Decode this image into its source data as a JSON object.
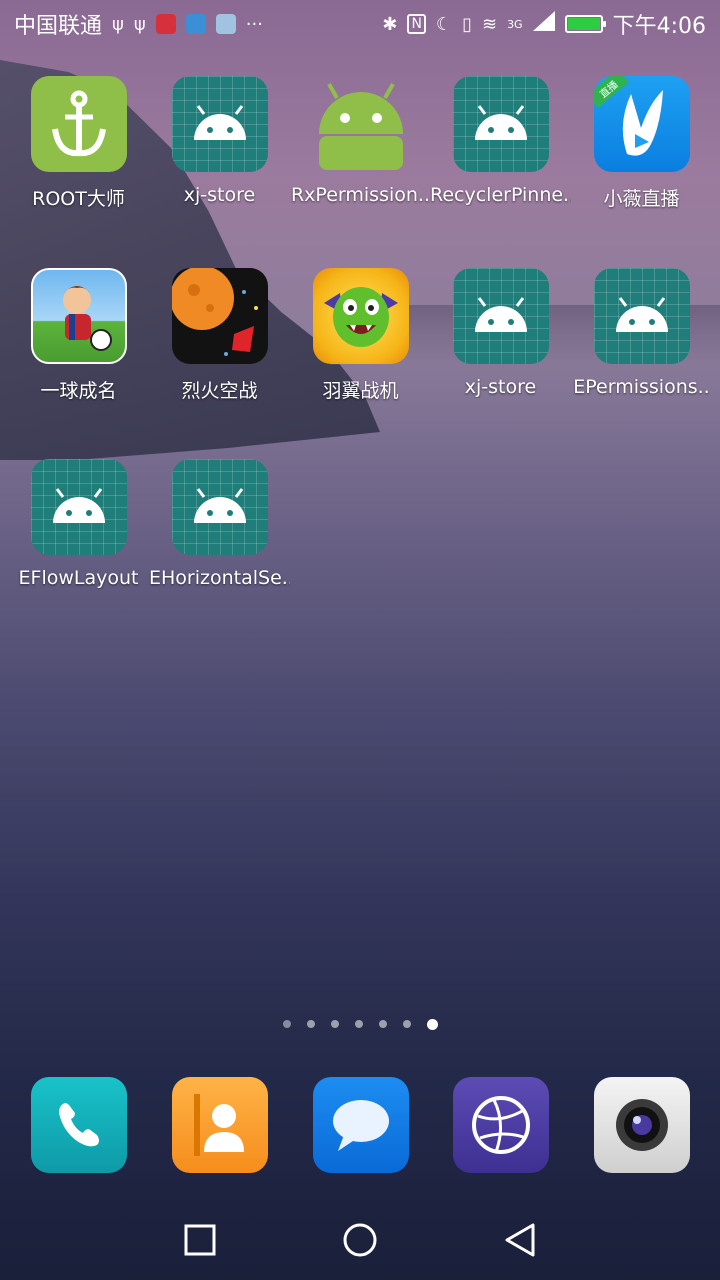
{
  "status_bar": {
    "carrier": "中国联通",
    "time": "下午4:06",
    "network": "3G",
    "icons": [
      "usb-icon",
      "usb-icon",
      "huawei-icon",
      "app-icon",
      "app-icon",
      "more-icon",
      "bluetooth-icon",
      "nfc-icon",
      "moon-icon",
      "vibrate-icon",
      "wifi-icon",
      "signal-icon",
      "battery-charging-icon"
    ]
  },
  "apps": [
    {
      "label": "ROOT大师",
      "icon": "anchor-icon"
    },
    {
      "label": "xj-store",
      "icon": "android-icon"
    },
    {
      "label": "RxPermission..",
      "icon": "android-icon"
    },
    {
      "label": "RecyclerPinne..",
      "icon": "android-icon"
    },
    {
      "label": "小薇直播",
      "icon": "rabbit-icon",
      "badge": "直播"
    },
    {
      "label": "一球成名",
      "icon": "soccer-icon"
    },
    {
      "label": "烈火空战",
      "icon": "planet-icon"
    },
    {
      "label": "羽翼战机",
      "icon": "dragon-icon"
    },
    {
      "label": "xj-store",
      "icon": "android-icon"
    },
    {
      "label": "EPermissions..",
      "icon": "android-icon"
    },
    {
      "label": "EFlowLayout",
      "icon": "android-icon"
    },
    {
      "label": "EHorizontalSe..",
      "icon": "android-icon"
    }
  ],
  "page_indicator": {
    "pages": 7,
    "current": 7
  },
  "dock": [
    {
      "name": "phone-icon"
    },
    {
      "name": "contacts-icon"
    },
    {
      "name": "messages-icon"
    },
    {
      "name": "browser-icon"
    },
    {
      "name": "camera-icon"
    }
  ],
  "navigation": [
    "recent-apps-icon",
    "home-icon",
    "back-icon"
  ],
  "colors": {
    "android_teal": "#1f7d7a",
    "android_green": "#8fbf48",
    "battery": "#2ecc40"
  }
}
